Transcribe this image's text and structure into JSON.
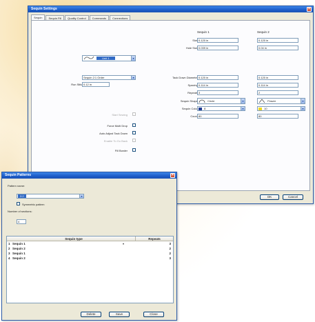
{
  "settings": {
    "title": "Sequin Settings",
    "tabs": [
      "Sequin",
      "Sequin Fill",
      "Quality Control",
      "Commands",
      "Connections"
    ],
    "columns": {
      "seq1": "Sequin 1",
      "seq2": "Sequin 2"
    },
    "size": {
      "label": "Size",
      "seq1": "0.120 in",
      "seq2": "0.120 in"
    },
    "hole_size": {
      "label": "Hole Size",
      "seq1": "0.039 in",
      "seq2": "0.04 in"
    },
    "style": {
      "label": "Style",
      "value": "Unit 1"
    },
    "pattern": {
      "label": "Pattern",
      "value": "Sequin 2:1 Order"
    },
    "run_stitch": {
      "label": "Run Stitch Length",
      "value": "0.12 in"
    },
    "tack_down": {
      "label": "Tack Down Diameter",
      "seq1": "0.120 in",
      "seq2": "0.120 in"
    },
    "spacing": {
      "label": "Spacing",
      "seq1": "0.114 in",
      "seq2": "0.114 in"
    },
    "repeats": {
      "label": "Repeats",
      "seq1": "3",
      "seq2": "2"
    },
    "shape": {
      "label": "Sequin Shape",
      "seq1": "Circle",
      "seq2": "Flower"
    },
    "color": {
      "label": "Sequin Color",
      "seq1": "8",
      "seq2": "10",
      "seq1_hex": "#203c94",
      "seq2_hex": "#f0d820"
    },
    "count": {
      "label": "Count",
      "seq1": "80",
      "seq2": "80"
    },
    "options": [
      {
        "label": "Start Sewing",
        "disabled": true
      },
      {
        "label": "Force Multi Drop",
        "disabled": false
      },
      {
        "label": "Auto Adjust Tack Down",
        "disabled": false
      },
      {
        "label": "Enable To Go Back",
        "disabled": true
      },
      {
        "label": "Fill Border",
        "disabled": false
      }
    ],
    "buttons": {
      "ok": "OK",
      "cancel": "Cancel"
    }
  },
  "patterns": {
    "title": "Sequin Patterns",
    "name_label": "Pattern name:",
    "name_value": "2:2",
    "symmetric_label": "Symmetric pattern",
    "sections_label": "Number of sections:",
    "sections_value": "4",
    "headers": {
      "type": "Sequin type",
      "repeats": "Repeats"
    },
    "rows": [
      {
        "num": "1",
        "type": "Sequin 1",
        "repeats": "3"
      },
      {
        "num": "2",
        "type": "Sequin 2",
        "repeats": "2"
      },
      {
        "num": "3",
        "type": "Sequin 1",
        "repeats": "2"
      },
      {
        "num": "4",
        "type": "Sequin 2",
        "repeats": "3"
      }
    ],
    "buttons": {
      "delete": "Delete",
      "save": "Save",
      "close": "Close"
    }
  }
}
